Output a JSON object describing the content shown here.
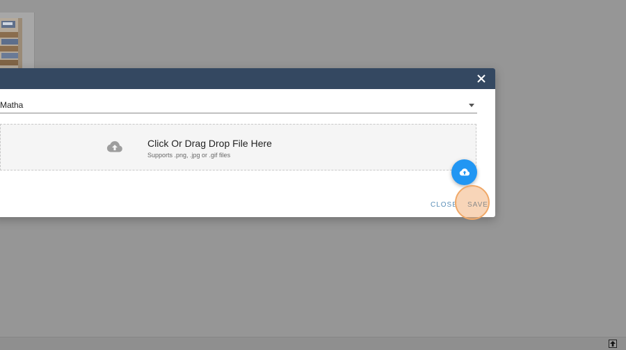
{
  "background": {
    "card_image": "product-shelf-image"
  },
  "modal": {
    "close_icon": "close-icon",
    "select": {
      "value": "Matha"
    },
    "dropzone": {
      "icon": "cloud-upload-icon",
      "title": "Click Or Drag Drop File Here",
      "subtitle": "Supports .png, .jpg or .gif files"
    },
    "upload_fab_icon": "cloud-upload-icon",
    "actions": {
      "close_label": "CLOSE",
      "save_label": "SAVE"
    }
  },
  "footer": {
    "scroll_top_icon": "arrow-up-icon"
  },
  "colors": {
    "overlay": "#969696",
    "header": "#344861",
    "fab": "#2196f3",
    "close_text": "#5b8fb8",
    "highlight": "#f0a868"
  }
}
